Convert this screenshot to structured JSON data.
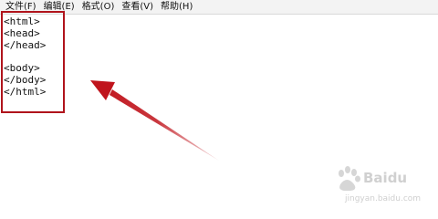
{
  "menubar": {
    "items": [
      {
        "label": "文件(F)"
      },
      {
        "label": "编辑(E)"
      },
      {
        "label": "格式(O)"
      },
      {
        "label": "查看(V)"
      },
      {
        "label": "帮助(H)"
      }
    ]
  },
  "editor": {
    "lines": [
      "<html>",
      "<head>",
      "</head>",
      "",
      "<body>",
      "</body>",
      "</html>"
    ]
  },
  "annotation": {
    "box_color": "#b0141c",
    "arrow_color": "#c0141c"
  },
  "watermark": {
    "brand": "Baidu",
    "caption": "jingyan.baidu.com"
  }
}
